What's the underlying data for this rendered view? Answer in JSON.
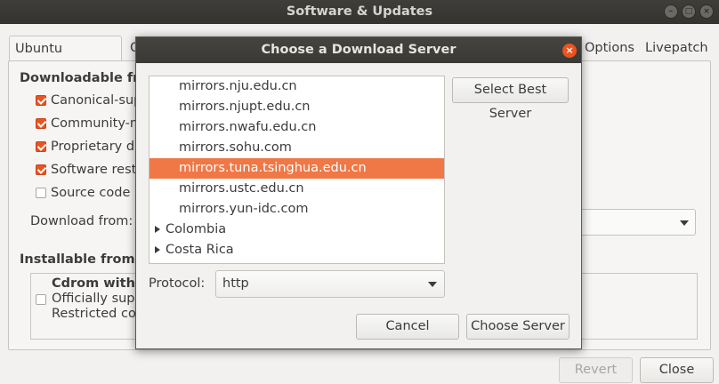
{
  "window": {
    "title": "Software & Updates",
    "controls": {
      "minimize": "–",
      "maximize": "□",
      "close": "×"
    }
  },
  "tabs": [
    {
      "label": "Ubuntu Software"
    },
    {
      "label": "O"
    },
    {
      "label": "Options"
    },
    {
      "label": "Livepatch"
    }
  ],
  "ubuntu_software": {
    "downloadable_title": "Downloadable fro",
    "sources": [
      {
        "label": "Canonical-supp",
        "checked": true
      },
      {
        "label": "Community-ma",
        "checked": true
      },
      {
        "label": "Proprietary dr",
        "checked": true
      },
      {
        "label": "Software restr",
        "checked": true
      },
      {
        "label": "Source code",
        "checked": false
      }
    ],
    "download_from_label": "Download from:",
    "installable_title": "Installable from C",
    "cdrom": {
      "title": "Cdrom with U",
      "line1": "Officially supp",
      "line2": "Restricted cop",
      "checked": false
    }
  },
  "footer": {
    "revert_label": "Revert",
    "close_label": "Close"
  },
  "dialog": {
    "title": "Choose a Download Server",
    "select_best_label": "Select Best Server",
    "servers": [
      {
        "label": "mirrors.nju.edu.cn",
        "kind": "mirror",
        "selected": false
      },
      {
        "label": "mirrors.njupt.edu.cn",
        "kind": "mirror",
        "selected": false
      },
      {
        "label": "mirrors.nwafu.edu.cn",
        "kind": "mirror",
        "selected": false
      },
      {
        "label": "mirrors.sohu.com",
        "kind": "mirror",
        "selected": false
      },
      {
        "label": "mirrors.tuna.tsinghua.edu.cn",
        "kind": "mirror",
        "selected": true
      },
      {
        "label": "mirrors.ustc.edu.cn",
        "kind": "mirror",
        "selected": false
      },
      {
        "label": "mirrors.yun-idc.com",
        "kind": "mirror",
        "selected": false
      },
      {
        "label": "Colombia",
        "kind": "country",
        "selected": false
      },
      {
        "label": "Costa Rica",
        "kind": "country",
        "selected": false
      }
    ],
    "protocol_label": "Protocol:",
    "protocol_value": "http",
    "cancel_label": "Cancel",
    "choose_label": "Choose Server"
  },
  "colors": {
    "accent": "#e95420",
    "selection": "#f07746",
    "titlebar": "#3a3935"
  }
}
